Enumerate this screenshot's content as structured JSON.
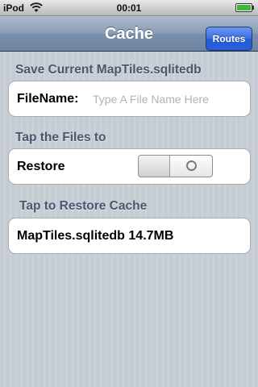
{
  "status_bar": {
    "carrier": "iPod",
    "time": "00:01",
    "wifi_icon": "wifi-icon",
    "battery_icon": "battery-icon",
    "battery_color": "#3cb83c"
  },
  "nav": {
    "title": "Cache",
    "right_button": "Routes",
    "button_color": "#2a5fd9"
  },
  "sections": {
    "save_header": "Save Current MapTiles.sqlitedb",
    "filename_label": "FileName:",
    "filename_value": "",
    "filename_placeholder": "Type A File Name Here",
    "restore_header": "Tap the Files to",
    "restore_label": "Restore",
    "restore_toggle_on": false,
    "cache_header": "Tap to Restore Cache",
    "cache_files": [
      {
        "name": "MapTiles.sqlitedb 14.7MB"
      }
    ]
  }
}
